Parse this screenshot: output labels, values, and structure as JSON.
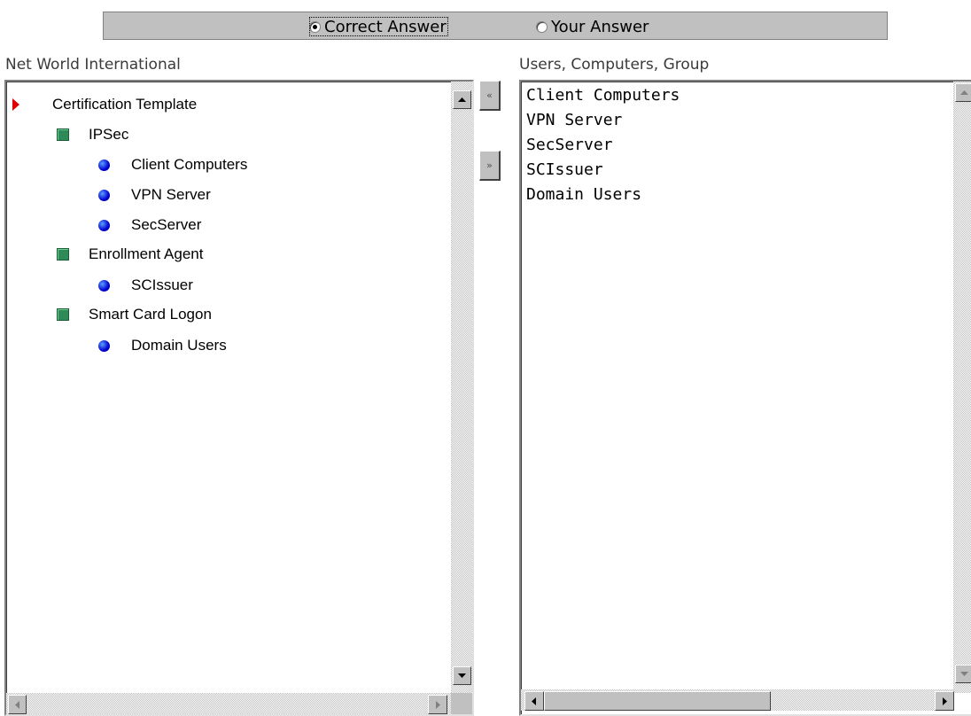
{
  "answer_bar": {
    "options": [
      {
        "label": "Correct Answer",
        "selected": true
      },
      {
        "label": "Your Answer",
        "selected": false
      }
    ]
  },
  "left_panel": {
    "label": "Net World International",
    "tree": [
      {
        "label": "Certification Template",
        "icon": "red-arrow-icon",
        "level": 0
      },
      {
        "label": "IPSec",
        "icon": "green-square-icon",
        "level": 1
      },
      {
        "label": "Client Computers",
        "icon": "blue-dot-icon",
        "level": 2
      },
      {
        "label": "VPN Server",
        "icon": "blue-dot-icon",
        "level": 2
      },
      {
        "label": "SecServer",
        "icon": "blue-dot-icon",
        "level": 2
      },
      {
        "label": "Enrollment Agent",
        "icon": "green-square-icon",
        "level": 1
      },
      {
        "label": "SCIssuer",
        "icon": "blue-dot-icon",
        "level": 2
      },
      {
        "label": "Smart Card Logon",
        "icon": "green-square-icon",
        "level": 1
      },
      {
        "label": "Domain Users",
        "icon": "blue-dot-icon",
        "level": 2
      }
    ]
  },
  "move_buttons": {
    "move_left_glyph": "«",
    "move_right_glyph": "»"
  },
  "right_panel": {
    "label": "Users, Computers, Group",
    "items": [
      "Client Computers",
      "VPN Server",
      "SecServer",
      "SCIssuer",
      "Domain Users"
    ]
  }
}
